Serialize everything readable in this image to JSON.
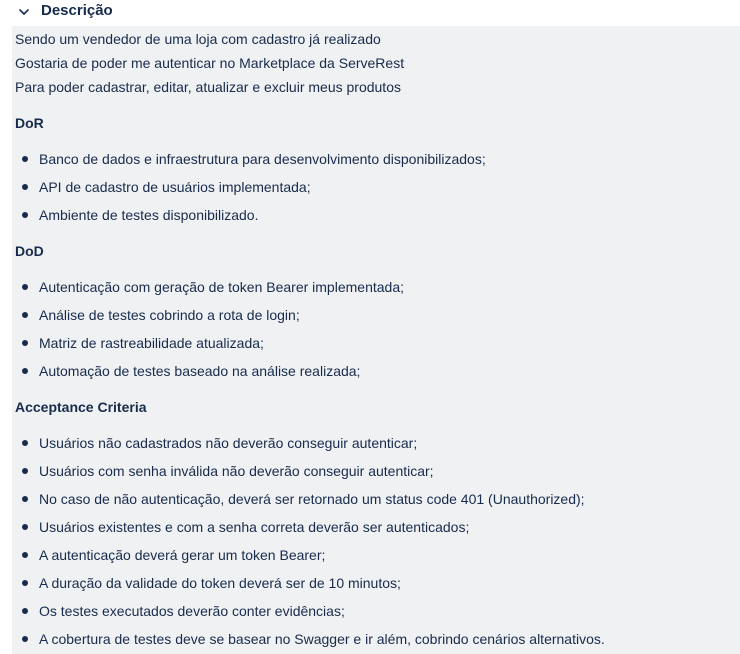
{
  "section": {
    "title": "Descrição"
  },
  "story": [
    "Sendo um vendedor de uma loja com cadastro já realizado",
    "Gostaria de poder me autenticar no Marketplace da ServeRest",
    "Para poder cadastrar, editar, atualizar e excluir meus produtos"
  ],
  "dor": {
    "title": "DoR",
    "items": [
      "Banco de dados e infraestrutura para desenvolvimento disponibilizados;",
      "API de cadastro de usuários implementada;",
      "Ambiente de testes disponibilizado."
    ]
  },
  "dod": {
    "title": "DoD",
    "items": [
      "Autenticação com geração de token Bearer implementada;",
      "Análise de testes cobrindo a rota de login;",
      "Matriz de rastreabilidade atualizada;",
      "Automação de testes baseado na análise realizada;"
    ]
  },
  "criteria": {
    "title": "Acceptance Criteria",
    "items": [
      "Usuários não cadastrados não deverão conseguir autenticar;",
      "Usuários com senha inválida não deverão conseguir autenticar;",
      "No caso de não autenticação, deverá ser retornado um status code 401 (Unauthorized);",
      "Usuários existentes e com a senha correta deverão ser autenticados;",
      "A autenticação deverá gerar um token Bearer;",
      "A duração da validade do token deverá ser de 10 minutos;",
      "Os testes executados deverão conter evidências;",
      "A cobertura de testes deve se basear no Swagger e ir além, cobrindo cenários alternativos."
    ]
  }
}
